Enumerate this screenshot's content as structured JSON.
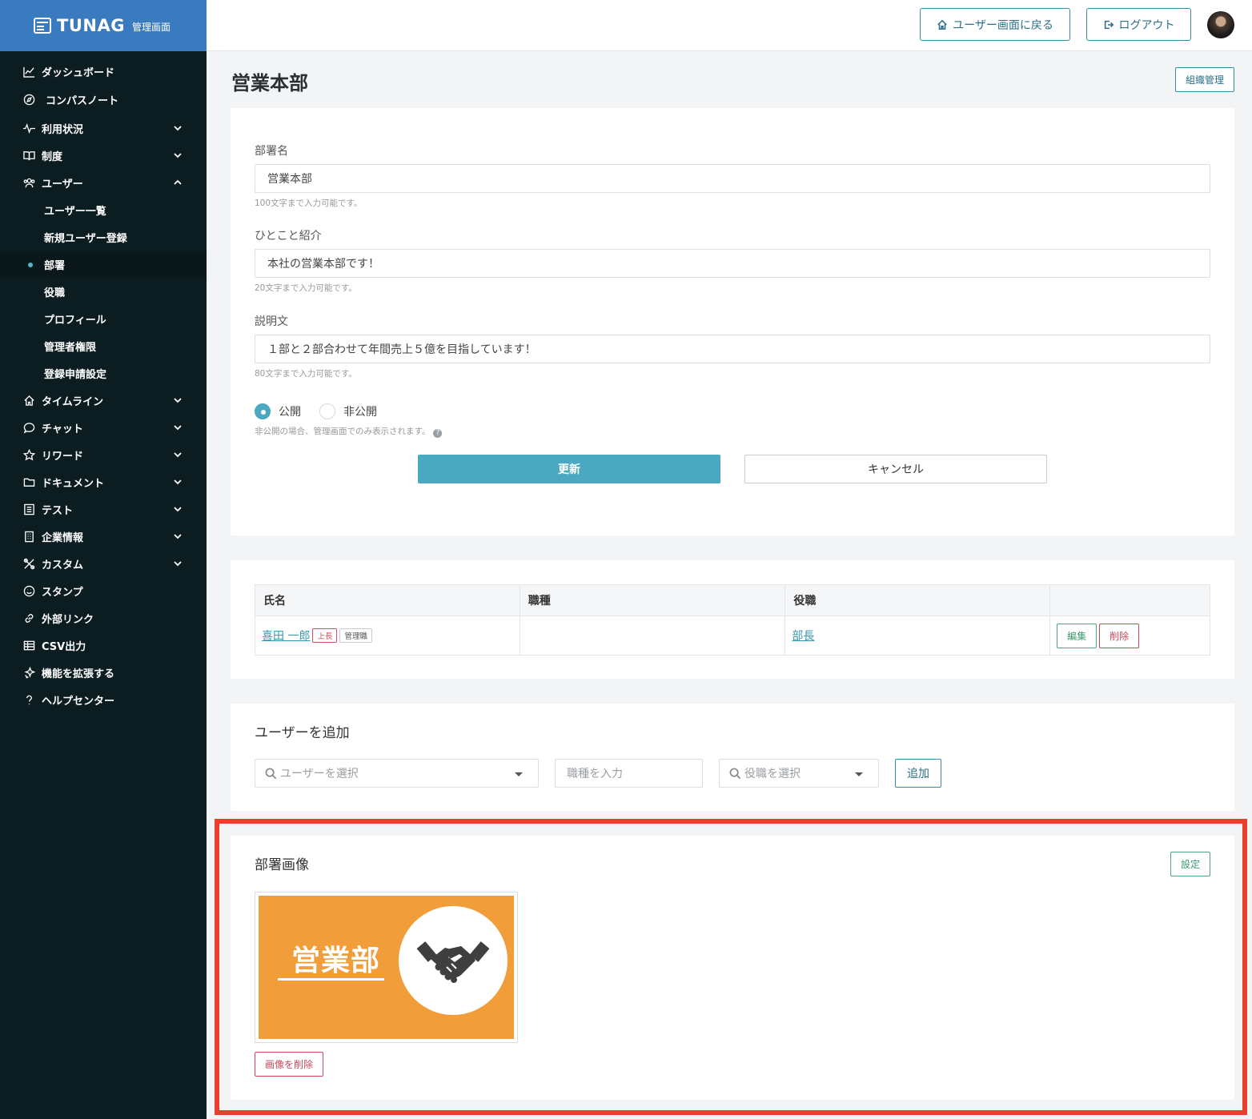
{
  "brand": {
    "name": "TUNAG",
    "sub": "管理画面"
  },
  "sidebar": {
    "items": [
      {
        "label": "ダッシュボード",
        "icon": "chart-line-icon"
      },
      {
        "label": "コンパスノート",
        "icon": "compass-icon"
      },
      {
        "label": "利用状況",
        "icon": "activity-icon",
        "expandable": true
      },
      {
        "label": "制度",
        "icon": "book-icon",
        "expandable": true
      },
      {
        "label": "ユーザー",
        "icon": "users-icon",
        "expanded": true
      },
      {
        "label": "タイムライン",
        "icon": "home-icon",
        "expandable": true
      },
      {
        "label": "チャット",
        "icon": "chat-icon",
        "expandable": true
      },
      {
        "label": "リワード",
        "icon": "star-icon",
        "expandable": true
      },
      {
        "label": "ドキュメント",
        "icon": "folder-icon",
        "expandable": true
      },
      {
        "label": "テスト",
        "icon": "checklist-icon",
        "expandable": true
      },
      {
        "label": "企業情報",
        "icon": "building-icon",
        "expandable": true
      },
      {
        "label": "カスタム",
        "icon": "tools-icon",
        "expandable": true
      },
      {
        "label": "スタンプ",
        "icon": "smile-icon"
      },
      {
        "label": "外部リンク",
        "icon": "link-icon"
      },
      {
        "label": "CSV出力",
        "icon": "table-icon"
      },
      {
        "label": "機能を拡張する",
        "icon": "sparkle-icon"
      },
      {
        "label": "ヘルプセンター",
        "icon": "question-icon"
      }
    ],
    "user_sub": [
      "ユーザー一覧",
      "新規ユーザー登録",
      "部署",
      "役職",
      "プロフィール",
      "管理者権限",
      "登録申請設定"
    ],
    "active_sub": "部署"
  },
  "topbar": {
    "back_label": "ユーザー画面に戻る",
    "logout_label": "ログアウト"
  },
  "page": {
    "title": "営業本部",
    "org_button": "組織管理"
  },
  "form": {
    "name_label": "部署名",
    "name_value": "営業本部",
    "name_help": "100文字まで入力可能です。",
    "intro_label": "ひとこと紹介",
    "intro_value": "本社の営業本部です！",
    "intro_help": "20文字まで入力可能です。",
    "desc_label": "説明文",
    "desc_value": "１部と２部合わせて年間売上５億を目指しています！",
    "desc_help": "80文字まで入力可能です。",
    "public_label": "公開",
    "private_label": "非公開",
    "visibility_selected": "公開",
    "visibility_help": "非公開の場合、管理画面でのみ表示されます。",
    "update_label": "更新",
    "cancel_label": "キャンセル"
  },
  "members": {
    "headers": [
      "氏名",
      "職種",
      "役職",
      ""
    ],
    "rows": [
      {
        "name": "喜田 一郎",
        "tags": [
          "上長",
          "管理職"
        ],
        "job": "",
        "position": "部長",
        "edit": "編集",
        "delete": "削除"
      }
    ]
  },
  "add_user": {
    "title": "ユーザーを追加",
    "user_placeholder": "ユーザーを選択",
    "job_placeholder": "職種を入力",
    "position_placeholder": "役職を選択",
    "add_label": "追加"
  },
  "dept_image": {
    "title": "部署画像",
    "set_label": "設定",
    "image_text": "営業部",
    "image_icon": "handshake-icon",
    "delete_label": "画像を削除",
    "colors": {
      "image_bg": "#f09d3a",
      "highlight": "#e8402b"
    }
  }
}
